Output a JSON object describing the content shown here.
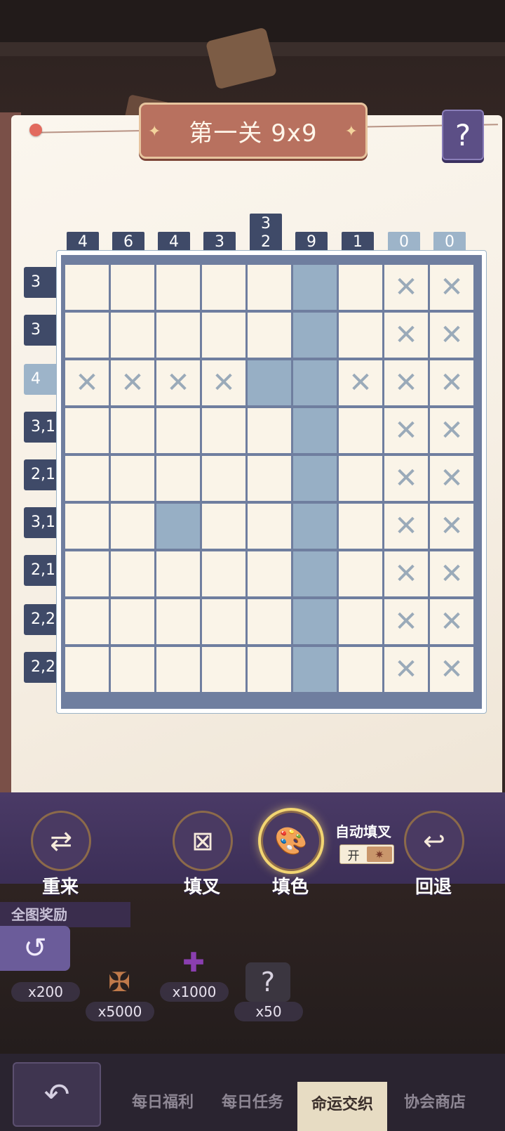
{
  "header": {
    "title": "第一关 9x9",
    "help_label": "?"
  },
  "puzzle": {
    "column_clues": [
      {
        "text": "4",
        "done": false
      },
      {
        "text": "6",
        "done": false
      },
      {
        "text": "4",
        "done": false
      },
      {
        "text": "3",
        "done": false
      },
      {
        "text": "3\n2",
        "done": false
      },
      {
        "text": "9",
        "done": false
      },
      {
        "text": "1",
        "done": false
      },
      {
        "text": "0",
        "done": true
      },
      {
        "text": "0",
        "done": true
      }
    ],
    "row_clues": [
      {
        "text": "3",
        "done": false
      },
      {
        "text": "3",
        "done": false
      },
      {
        "text": "4",
        "done": true
      },
      {
        "text": "3,1",
        "done": false
      },
      {
        "text": "2,1",
        "done": false
      },
      {
        "text": "3,1",
        "done": false
      },
      {
        "text": "2,1",
        "done": false
      },
      {
        "text": "2,2",
        "done": false
      },
      {
        "text": "2,2",
        "done": false
      }
    ],
    "grid": [
      ".....F.XX",
      ".....F.XX",
      "XXXXFFXXX",
      ".....F.XX",
      ".....F.XX",
      "..F..F.XX",
      ".....F.XX",
      ".....F.XX",
      ".....F.XX"
    ],
    "mark_symbol": "✕"
  },
  "toolbar": {
    "restart_label": "重来",
    "fill_x_label": "填叉",
    "fill_color_label": "填色",
    "undo_label": "回退",
    "auto_fill_label": "自动填叉",
    "auto_fill_state": "开",
    "active_tool": "fill_color"
  },
  "rewards": {
    "title": "全图奖励",
    "items": [
      {
        "qty": "x200",
        "icon": "coin-stack-icon"
      },
      {
        "qty": "x5000",
        "icon": "winged-badge-icon"
      },
      {
        "qty": "x1000",
        "icon": "purple-puzzle-piece-icon"
      },
      {
        "qty": "x50",
        "icon": "mystery-card-icon"
      }
    ]
  },
  "nav": {
    "tabs": [
      {
        "label": "每日福利",
        "active": false
      },
      {
        "label": "每日任务",
        "active": false
      },
      {
        "label": "命运交织",
        "active": true
      },
      {
        "label": "协会商店",
        "active": false
      }
    ]
  },
  "colors": {
    "cell_empty": "#faf4e8",
    "cell_filled": "#97afc5",
    "grid_line": "#6f7e9f",
    "clue_bg": "#3f4a68",
    "clue_done_bg": "#9db4c9"
  }
}
